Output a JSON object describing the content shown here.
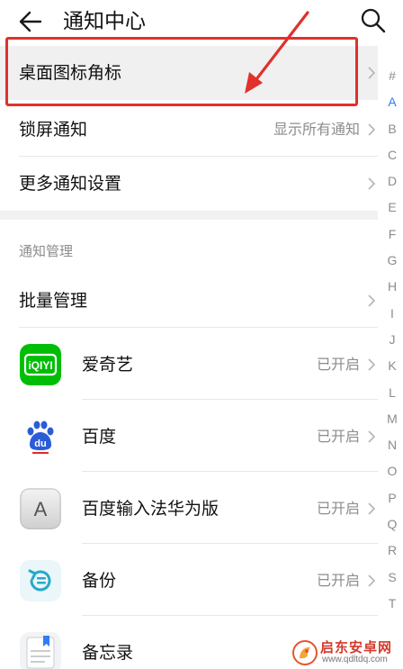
{
  "header": {
    "title": "通知中心",
    "back_icon": "back-arrow-icon",
    "search_icon": "search-icon"
  },
  "settings": {
    "badge_label": "桌面图标角标",
    "lock_label": "锁屏通知",
    "lock_value": "显示所有通知",
    "more_label": "更多通知设置"
  },
  "section": {
    "title": "通知管理",
    "batch_label": "批量管理"
  },
  "apps": [
    {
      "name": "爱奇艺",
      "status": "已开启",
      "icon": "iqiyi-icon"
    },
    {
      "name": "百度",
      "status": "已开启",
      "icon": "baidu-icon"
    },
    {
      "name": "百度输入法华为版",
      "status": "已开启",
      "icon": "baidu-input-icon"
    },
    {
      "name": "备份",
      "status": "已开启",
      "icon": "backup-icon"
    },
    {
      "name": "备忘录",
      "status": "",
      "icon": "notepad-icon"
    }
  ],
  "alpha_index": [
    "#",
    "A",
    "B",
    "C",
    "D",
    "E",
    "F",
    "G",
    "H",
    "I",
    "J",
    "K",
    "L",
    "M",
    "N",
    "O",
    "P",
    "Q",
    "R",
    "S",
    "T"
  ],
  "alpha_active": "A",
  "watermark": {
    "text": "启东安卓网",
    "url": "www.qdltdq.com"
  },
  "colors": {
    "accent": "#2f7df6",
    "annotation": "#e0312b",
    "iqiyi": "#00be06",
    "secondary_text": "#8c8c8c"
  }
}
